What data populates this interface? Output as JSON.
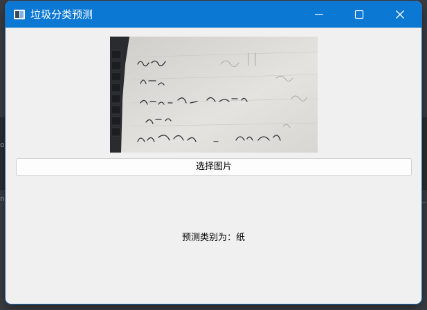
{
  "window": {
    "title": "垃圾分类预测",
    "titlebar_color": "#0b78d4"
  },
  "controls": {
    "minimize_icon": "minimize-icon",
    "maximize_icon": "maximize-icon",
    "close_icon": "close-icon"
  },
  "preview_image": {
    "icon": "handwritten-notes-photo"
  },
  "select_button": {
    "label": "选择图片"
  },
  "result": {
    "prefix": "预测类别为：",
    "value": "纸"
  },
  "background": {
    "left_fragment_top": "op",
    "left_fragment_bottom": "n",
    "right_fragment": "_("
  }
}
